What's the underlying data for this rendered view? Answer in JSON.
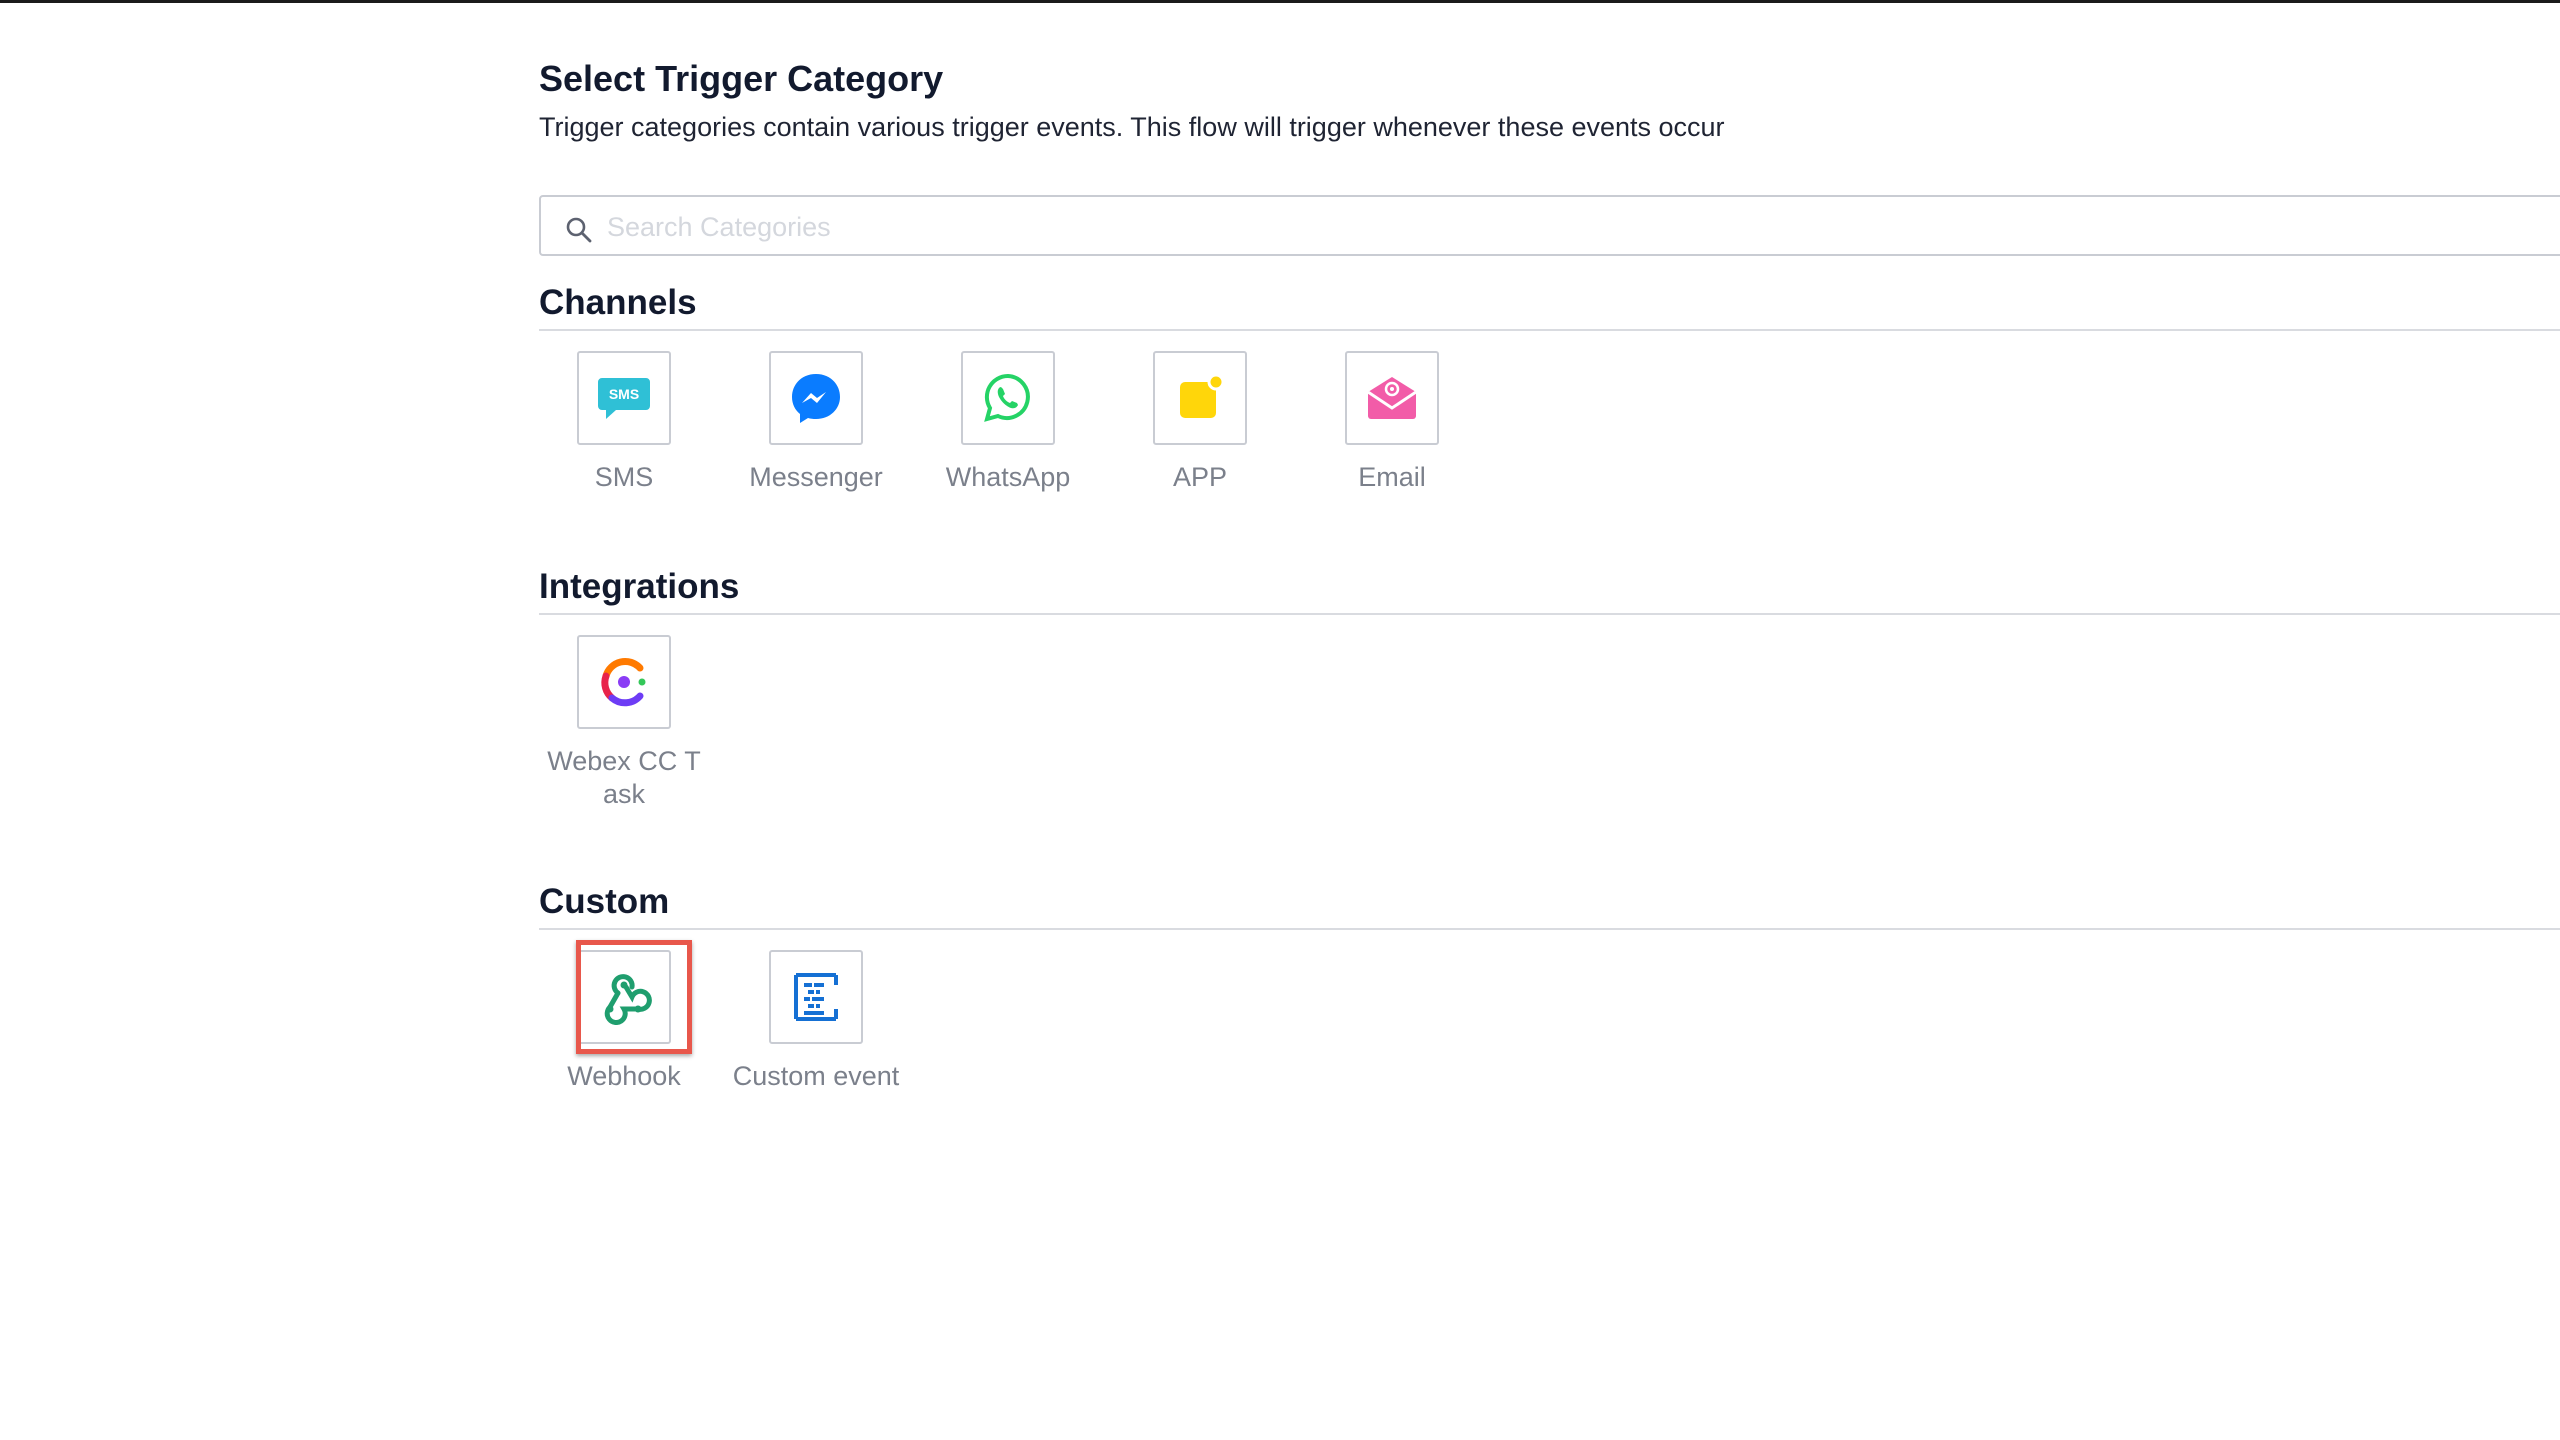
{
  "header": {
    "title": "Select Trigger Category",
    "subtitle": "Trigger categories contain various trigger events. This flow will trigger whenever these events occur"
  },
  "search": {
    "placeholder": "Search Categories",
    "value": "",
    "icon": "search-icon"
  },
  "sections": [
    {
      "title": "Channels",
      "items": [
        {
          "label": "SMS",
          "icon": "sms-icon",
          "color": "#2fc0d6"
        },
        {
          "label": "Messenger",
          "icon": "messenger-icon",
          "color": "#0a7cff"
        },
        {
          "label": "WhatsApp",
          "icon": "whatsapp-icon",
          "color": "#25d366"
        },
        {
          "label": "APP",
          "icon": "app-notification-icon",
          "color": "#ffd60a"
        },
        {
          "label": "Email",
          "icon": "email-icon",
          "color": "#f25ca8"
        }
      ]
    },
    {
      "title": "Integrations",
      "items": [
        {
          "label": "Webex CC Task",
          "icon": "webex-cc-icon",
          "color": "#7a3cff"
        }
      ]
    },
    {
      "title": "Custom",
      "items": [
        {
          "label": "Webhook",
          "icon": "webhook-icon",
          "color": "#1f9e6e",
          "highlighted": true
        },
        {
          "label": "Custom event",
          "icon": "custom-event-icon",
          "color": "#1570d4"
        }
      ]
    }
  ],
  "colors": {
    "highlight": "#e8574b",
    "label": "#7b808b",
    "border": "#c9ccd3"
  }
}
